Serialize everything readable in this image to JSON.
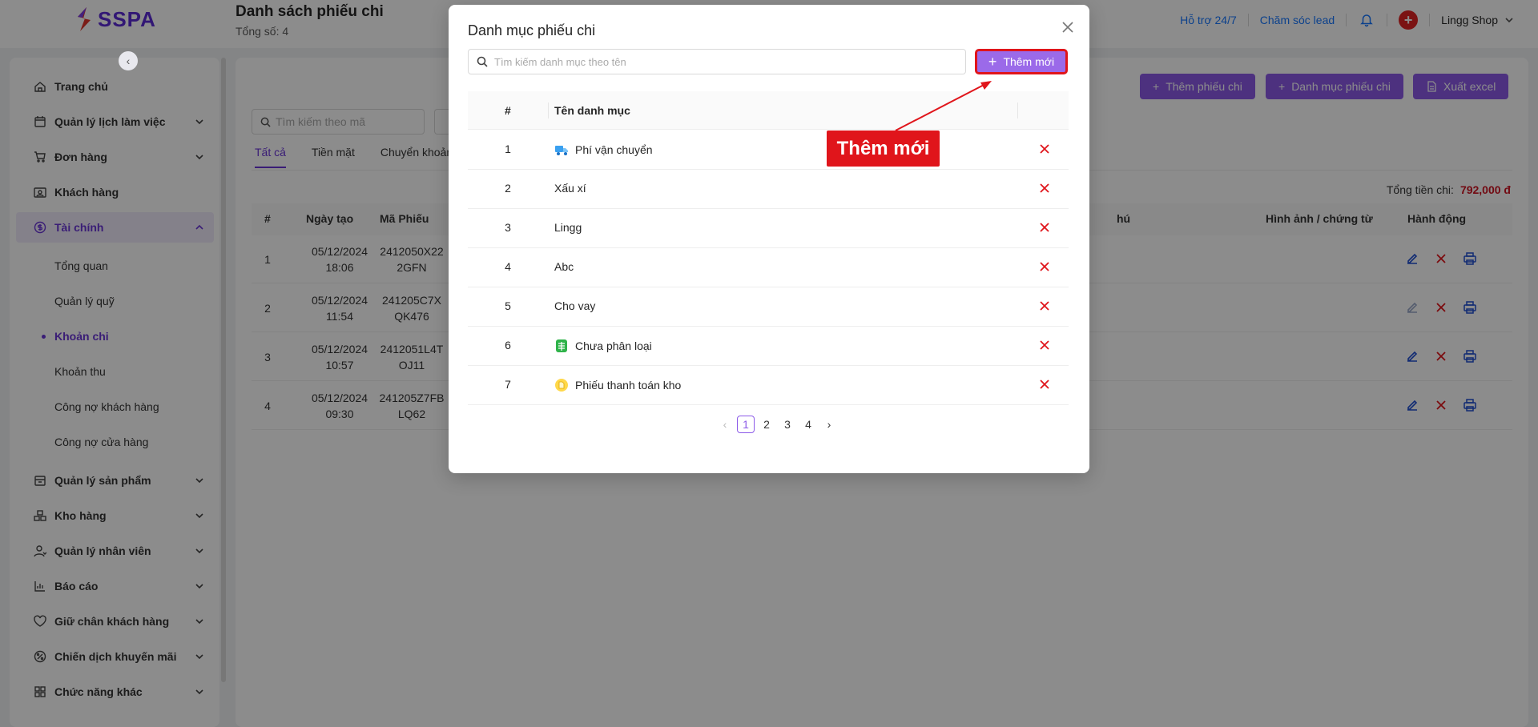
{
  "header": {
    "logo_text": "SSPA",
    "page_title": "Danh sách phiếu chi",
    "page_count": "Tổng số: 4",
    "support_link": "Hỗ trợ 24/7",
    "lead_link": "Chăm sóc lead",
    "shop_name": "Lingg Shop",
    "brand_color": "#5b2bd6"
  },
  "sidebar": {
    "items": [
      {
        "label": "Trang chủ",
        "icon": "home-icon"
      },
      {
        "label": "Quản lý lịch làm việc",
        "icon": "calendar-icon"
      },
      {
        "label": "Đơn hàng",
        "icon": "cart-icon"
      },
      {
        "label": "Khách hàng",
        "icon": "contact-icon"
      },
      {
        "label": "Tài chính",
        "icon": "dollar-icon"
      },
      {
        "label": "Quản lý sản phẩm",
        "icon": "box-icon"
      },
      {
        "label": "Kho hàng",
        "icon": "warehouse-icon"
      },
      {
        "label": "Quản lý nhân viên",
        "icon": "user-icon"
      },
      {
        "label": "Báo cáo",
        "icon": "chart-icon"
      },
      {
        "label": "Giữ chân khách hàng",
        "icon": "heart-icon"
      },
      {
        "label": "Chiến dịch khuyến mãi",
        "icon": "promo-icon"
      },
      {
        "label": "Chức năng khác",
        "icon": "grid-icon"
      }
    ],
    "finance_sub": [
      "Tổng quan",
      "Quản lý quỹ",
      "Khoản chi",
      "Khoản thu",
      "Công nợ khách hàng",
      "Công nợ cửa hàng"
    ]
  },
  "main": {
    "btn_add_expense": "Thêm phiếu chi",
    "btn_categories": "Danh mục phiếu chi",
    "btn_export": "Xuất excel",
    "search_placeholder": "Tìm kiếm theo mã",
    "tabs": [
      "Tất cả",
      "Tiền mặt",
      "Chuyển khoản"
    ],
    "total_label": "Tổng tiền chi:",
    "total_value": "792,000 đ",
    "columns": {
      "index": "#",
      "created": "Ngày tạo",
      "code": "Mã Phiếu",
      "note_partial": "hú",
      "images": "Hình ảnh / chứng từ",
      "actions": "Hành động"
    },
    "rows": [
      {
        "index": "1",
        "date": "05/12/2024",
        "time": "18:06",
        "code1": "2412050X22",
        "code2": "2GFN"
      },
      {
        "index": "2",
        "date": "05/12/2024",
        "time": "11:54",
        "code1": "241205C7X",
        "code2": "QK476"
      },
      {
        "index": "3",
        "date": "05/12/2024",
        "time": "10:57",
        "code1": "2412051L4T",
        "code2": "OJ11"
      },
      {
        "index": "4",
        "date": "05/12/2024",
        "time": "09:30",
        "code1": "241205Z7FB",
        "code2": "LQ62"
      }
    ]
  },
  "modal": {
    "title": "Danh mục phiếu chi",
    "search_placeholder": "Tìm kiếm danh mục theo tên",
    "add_button": "Thêm mới",
    "col_index": "#",
    "col_name": "Tên danh mục",
    "categories": [
      {
        "index": "1",
        "name": "Phí vận chuyển",
        "icon": "truck-icon"
      },
      {
        "index": "2",
        "name": "Xấu xí",
        "icon": ""
      },
      {
        "index": "3",
        "name": "Lingg",
        "icon": ""
      },
      {
        "index": "4",
        "name": "Abc",
        "icon": ""
      },
      {
        "index": "5",
        "name": "Cho vay",
        "icon": ""
      },
      {
        "index": "6",
        "name": "Chưa phân loại",
        "icon": "sheet-icon"
      },
      {
        "index": "7",
        "name": "Phiếu thanh toán kho",
        "icon": "document-icon"
      }
    ],
    "pages": [
      "1",
      "2",
      "3",
      "4"
    ],
    "current_page": "1"
  },
  "annotation": {
    "label": "Thêm mới",
    "color": "#e0151b"
  }
}
